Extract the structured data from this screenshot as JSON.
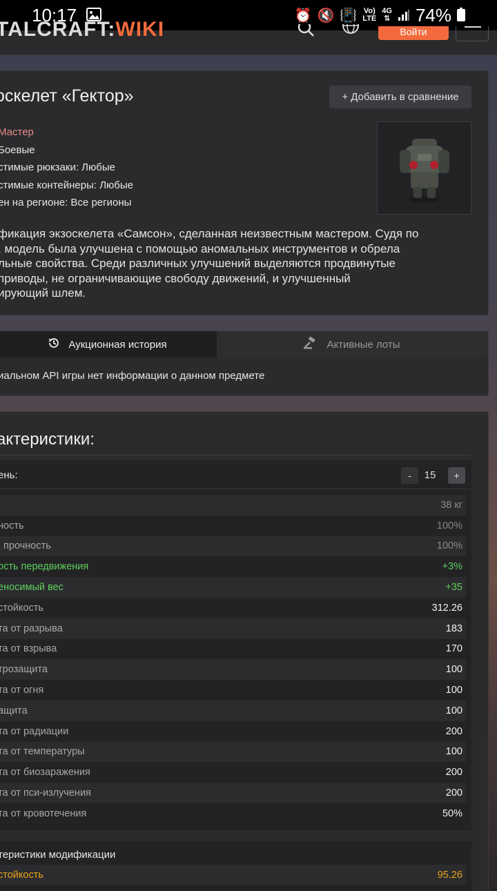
{
  "status_bar": {
    "time": "10:17",
    "battery": "74%",
    "network_top": "Vo)",
    "network_bottom": "LTE",
    "gen": "4G"
  },
  "header": {
    "logo_main": "TALCRAFT:",
    "logo_accent": "WIKI",
    "login_label": "Войти"
  },
  "item": {
    "title": "оскелет «Гектор»",
    "compare_label": "+ Добавить в сравнение",
    "rank": "Мастер",
    "category": "Боевые",
    "backpacks": "стимые рюкзаки: Любые",
    "containers": "стимые контейнеры: Любые",
    "region": "ен на регионе: Все регионы",
    "desc_lines": [
      "фикация экзоскелета «Самсон», сделанная неизвестным мастером. Судя по",
      ", модель была улучшена с помощью аномальных инструментов и обрела",
      "льные свойства. Среди различных улучшений выделяются продвинутые",
      "приводы, не ограничивающие свободу движений, и улучшенный",
      "ирующий шлем."
    ]
  },
  "tabs": {
    "auction_history": "Аукционная история",
    "active_lots": "Активные лоты",
    "no_info": "иальном API игры нет информации о данном предмете"
  },
  "stats": {
    "title": "актеристики:",
    "level_label": "ень:",
    "minus": "-",
    "plus": "+",
    "level_value": "15",
    "rows": [
      {
        "label": "",
        "value": "38 кг"
      },
      {
        "label": "ность",
        "value": "100%"
      },
      {
        "label": ". прочность",
        "value": "100%"
      },
      {
        "label": "ость передвижения",
        "value": "+3%"
      },
      {
        "label": "еносимый вес",
        "value": "+35"
      },
      {
        "label": "стойкость",
        "value": "312.26"
      },
      {
        "label": "та от разрыва",
        "value": "183"
      },
      {
        "label": "та от взрыва",
        "value": "170"
      },
      {
        "label": "трозащита",
        "value": "100"
      },
      {
        "label": "та от огня",
        "value": "100"
      },
      {
        "label": "ащита",
        "value": "100"
      },
      {
        "label": "та от радиации",
        "value": "200"
      },
      {
        "label": "та от температуры",
        "value": "100"
      },
      {
        "label": "та от биозаражения",
        "value": "200"
      },
      {
        "label": "та от пси-излучения",
        "value": "200"
      },
      {
        "label": "та от кровотечения",
        "value": "50%"
      }
    ],
    "mod_title": "теристики модификации",
    "mod_row_label": "стойкость",
    "mod_row_value": "95.26"
  },
  "colors": {
    "accent": "#f26a3d",
    "positive": "#5ccf5c",
    "mod": "#e8a41a",
    "rank": "#e88a8a"
  }
}
